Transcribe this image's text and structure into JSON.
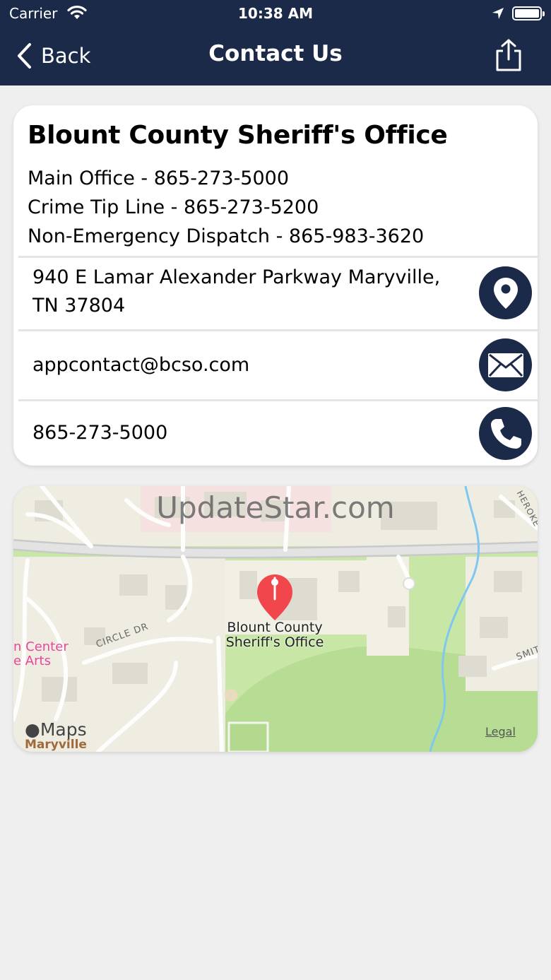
{
  "status_bar": {
    "carrier": "Carrier",
    "time": "10:38 AM"
  },
  "nav": {
    "back_label": "Back",
    "title": "Contact Us"
  },
  "contact": {
    "org_name": "Blount County Sheriff's Office",
    "lines": [
      "Main Office - 865-273-5000",
      "Crime Tip Line - 865-273-5200",
      "Non-Emergency Dispatch - 865-983-3620"
    ],
    "address_line1": "940 E Lamar Alexander Parkway Maryville,",
    "address_line2": "TN 37804",
    "email": "appcontact@bcso.com",
    "phone": "865-273-5000"
  },
  "map": {
    "pin_label_line1": "Blount County",
    "pin_label_line2": "Sheriff's Office",
    "street_circle": "CIRCLE DR",
    "street_smith": "SMIT",
    "street_cherokee": "HEROKE",
    "poi_line1": "n Center",
    "poi_line2": "e Arts",
    "city": "Maryville",
    "brand": "Maps",
    "legal": "Legal"
  },
  "watermark": "UpdateStar.com",
  "colors": {
    "nav_bg": "#1c2a4a",
    "pin": "#f0464c",
    "poi": "#e8479a"
  }
}
